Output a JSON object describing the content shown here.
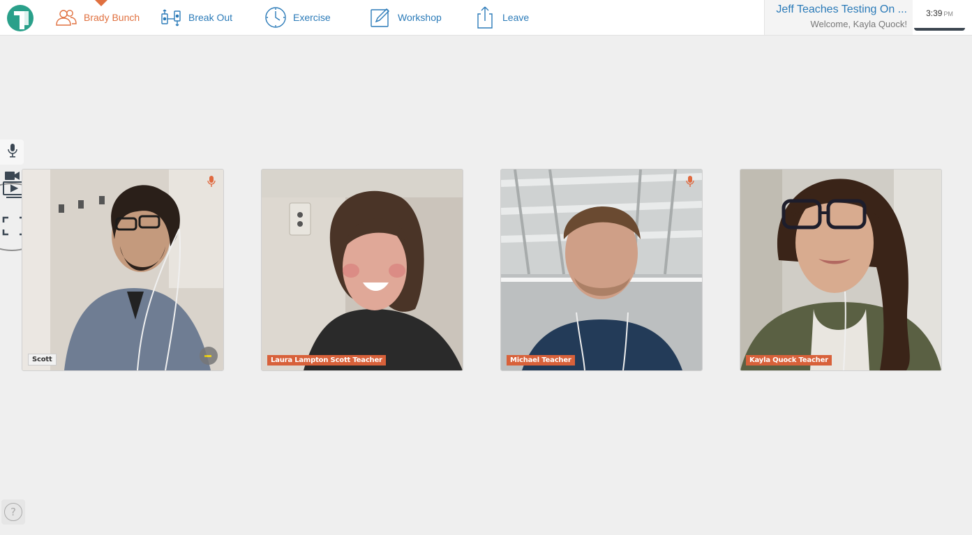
{
  "nav": {
    "items": [
      {
        "label": "Brady Bunch",
        "icon": "people-icon",
        "active": true
      },
      {
        "label": "Break Out",
        "icon": "breakout-icon"
      },
      {
        "label": "Exercise",
        "icon": "clock-icon"
      },
      {
        "label": "Workshop",
        "icon": "pencil-icon"
      },
      {
        "label": "Leave",
        "icon": "share-icon"
      }
    ]
  },
  "session": {
    "title": "Jeff Teaches Testing On ...",
    "welcome": "Welcome, Kayla Quock!"
  },
  "clock": {
    "time": "3:39",
    "ampm": "PM"
  },
  "participants": [
    {
      "name": "Scott",
      "muted_icon": true,
      "volume_indicator": true
    },
    {
      "name": "Laura Lampton Scott Teacher"
    },
    {
      "name": "Michael Teacher",
      "muted_icon": true
    },
    {
      "name": "Kayla Quock Teacher"
    }
  ],
  "help": {
    "label": "?"
  },
  "colors": {
    "accent_blue": "#2a7ab8",
    "accent_orange": "#e0703f",
    "tag_orange": "#d8613a"
  }
}
